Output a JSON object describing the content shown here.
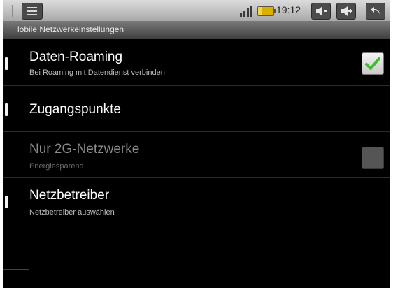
{
  "status_bar": {
    "time": "19:12",
    "icons": [
      "menu-icon",
      "signal-icon",
      "battery-icon",
      "volume-down-icon",
      "volume-up-icon",
      "back-icon"
    ]
  },
  "title_bar": {
    "title": "lobile Netzwerkeinstellungen"
  },
  "settings": [
    {
      "title": "Daten-Roaming",
      "subtitle": "Bei Roaming mit Datendienst verbinden",
      "checked": true,
      "enabled": true
    },
    {
      "title": "Zugangspunkte",
      "subtitle": "",
      "enabled": true
    },
    {
      "title": "Nur 2G-Netzwerke",
      "subtitle": "Energiesparend",
      "checked": false,
      "enabled": false
    },
    {
      "title": "Netzbetreiber",
      "subtitle": "Netzbetreiber auswählen",
      "enabled": true
    }
  ],
  "colors": {
    "background": "#000000",
    "check_green": "#3cbf2e",
    "battery": "#d9b000"
  }
}
